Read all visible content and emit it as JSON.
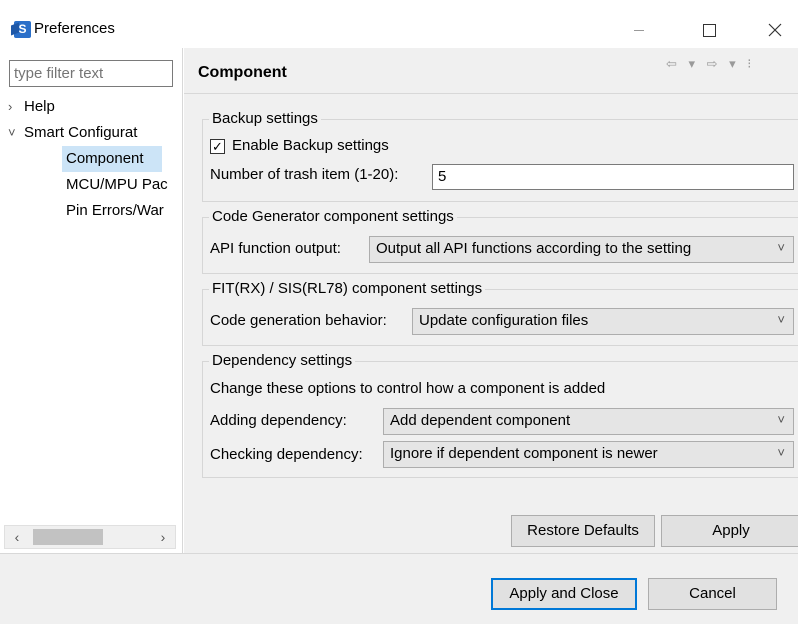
{
  "window": {
    "title": "Preferences",
    "app_icon_letter": "S"
  },
  "left": {
    "filter_placeholder": "type filter text",
    "tree": [
      {
        "label": "Help",
        "arrow": "›"
      },
      {
        "label": "Smart Configurat",
        "arrow": "˅"
      },
      {
        "label": "Component"
      },
      {
        "label": "MCU/MPU Pac"
      },
      {
        "label": "Pin Errors/War"
      }
    ],
    "scroll_left": "‹",
    "scroll_right": "›"
  },
  "page": {
    "title": "Component",
    "nav_icons": "⇦ ▾ ⇨ ▾ ⁝"
  },
  "backup": {
    "title": "Backup settings",
    "enable_label": "Enable Backup settings",
    "enable_checked": "✓",
    "trash_label": "Number of trash item (1-20):",
    "trash_value": "5"
  },
  "codegen": {
    "title": "Code Generator component settings",
    "api_label": "API function output:",
    "api_value": "Output all API functions according to the setting"
  },
  "fit": {
    "title": "FIT(RX) / SIS(RL78) component settings",
    "behavior_label": "Code generation behavior:",
    "behavior_value": "Update configuration files"
  },
  "dependency": {
    "title": "Dependency settings",
    "description": "Change these options to control how a component is added",
    "adding_label": "Adding dependency:",
    "adding_value": "Add dependent component",
    "checking_label": "Checking dependency:",
    "checking_value": "Ignore if dependent component is newer"
  },
  "combo_arrow": "˅",
  "buttons": {
    "restore_defaults": "Restore Defaults",
    "apply": "Apply",
    "apply_and_close": "Apply and Close",
    "cancel": "Cancel"
  },
  "colors": {
    "selection": "#cce4f7",
    "pane_bg": "#f0f0f0",
    "accent": "#0078d7"
  }
}
